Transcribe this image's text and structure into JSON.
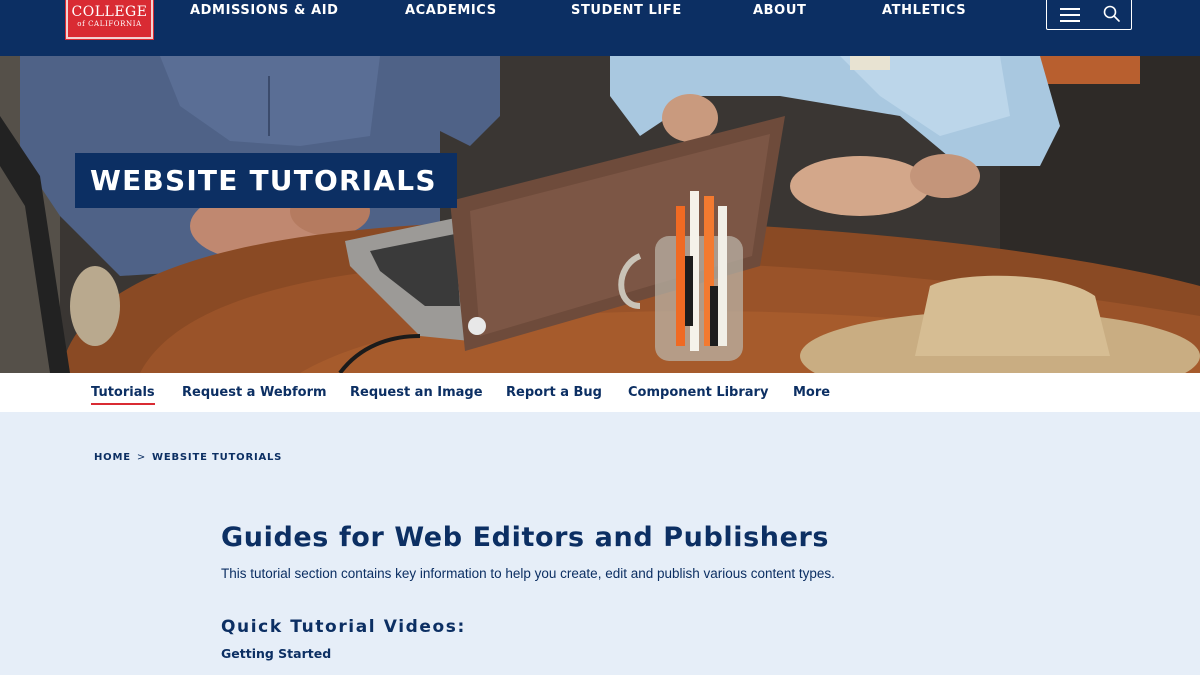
{
  "header": {
    "logo": {
      "main": "COLLEGE",
      "sub": "of CALIFORNIA"
    },
    "nav": [
      "ADMISSIONS & AID",
      "ACADEMICS",
      "STUDENT LIFE",
      "ABOUT",
      "ATHLETICS"
    ],
    "tools": {
      "menu_icon": "hamburger-menu-icon",
      "search_icon": "search-icon"
    }
  },
  "hero": {
    "title": "WEBSITE TUTORIALS",
    "image": "hero-photo"
  },
  "subnav": {
    "items": [
      {
        "label": "Tutorials",
        "active": true
      },
      {
        "label": "Request a Webform",
        "active": false
      },
      {
        "label": "Request an Image",
        "active": false
      },
      {
        "label": "Report a Bug",
        "active": false
      },
      {
        "label": "Component Library",
        "active": false
      },
      {
        "label": "More",
        "active": false
      }
    ]
  },
  "breadcrumb": {
    "home": "HOME",
    "separator": ">",
    "current": "WEBSITE TUTORIALS"
  },
  "main": {
    "heading": "Guides for Web Editors and Publishers",
    "intro": "This tutorial section contains key information to help you create, edit and publish various content types.",
    "section_heading": "Quick Tutorial Videos:",
    "subsection_heading": "Getting Started"
  },
  "colors": {
    "navy": "#0c2f63",
    "brand_red": "#d92b33",
    "page_bg": "#e6eef8"
  }
}
